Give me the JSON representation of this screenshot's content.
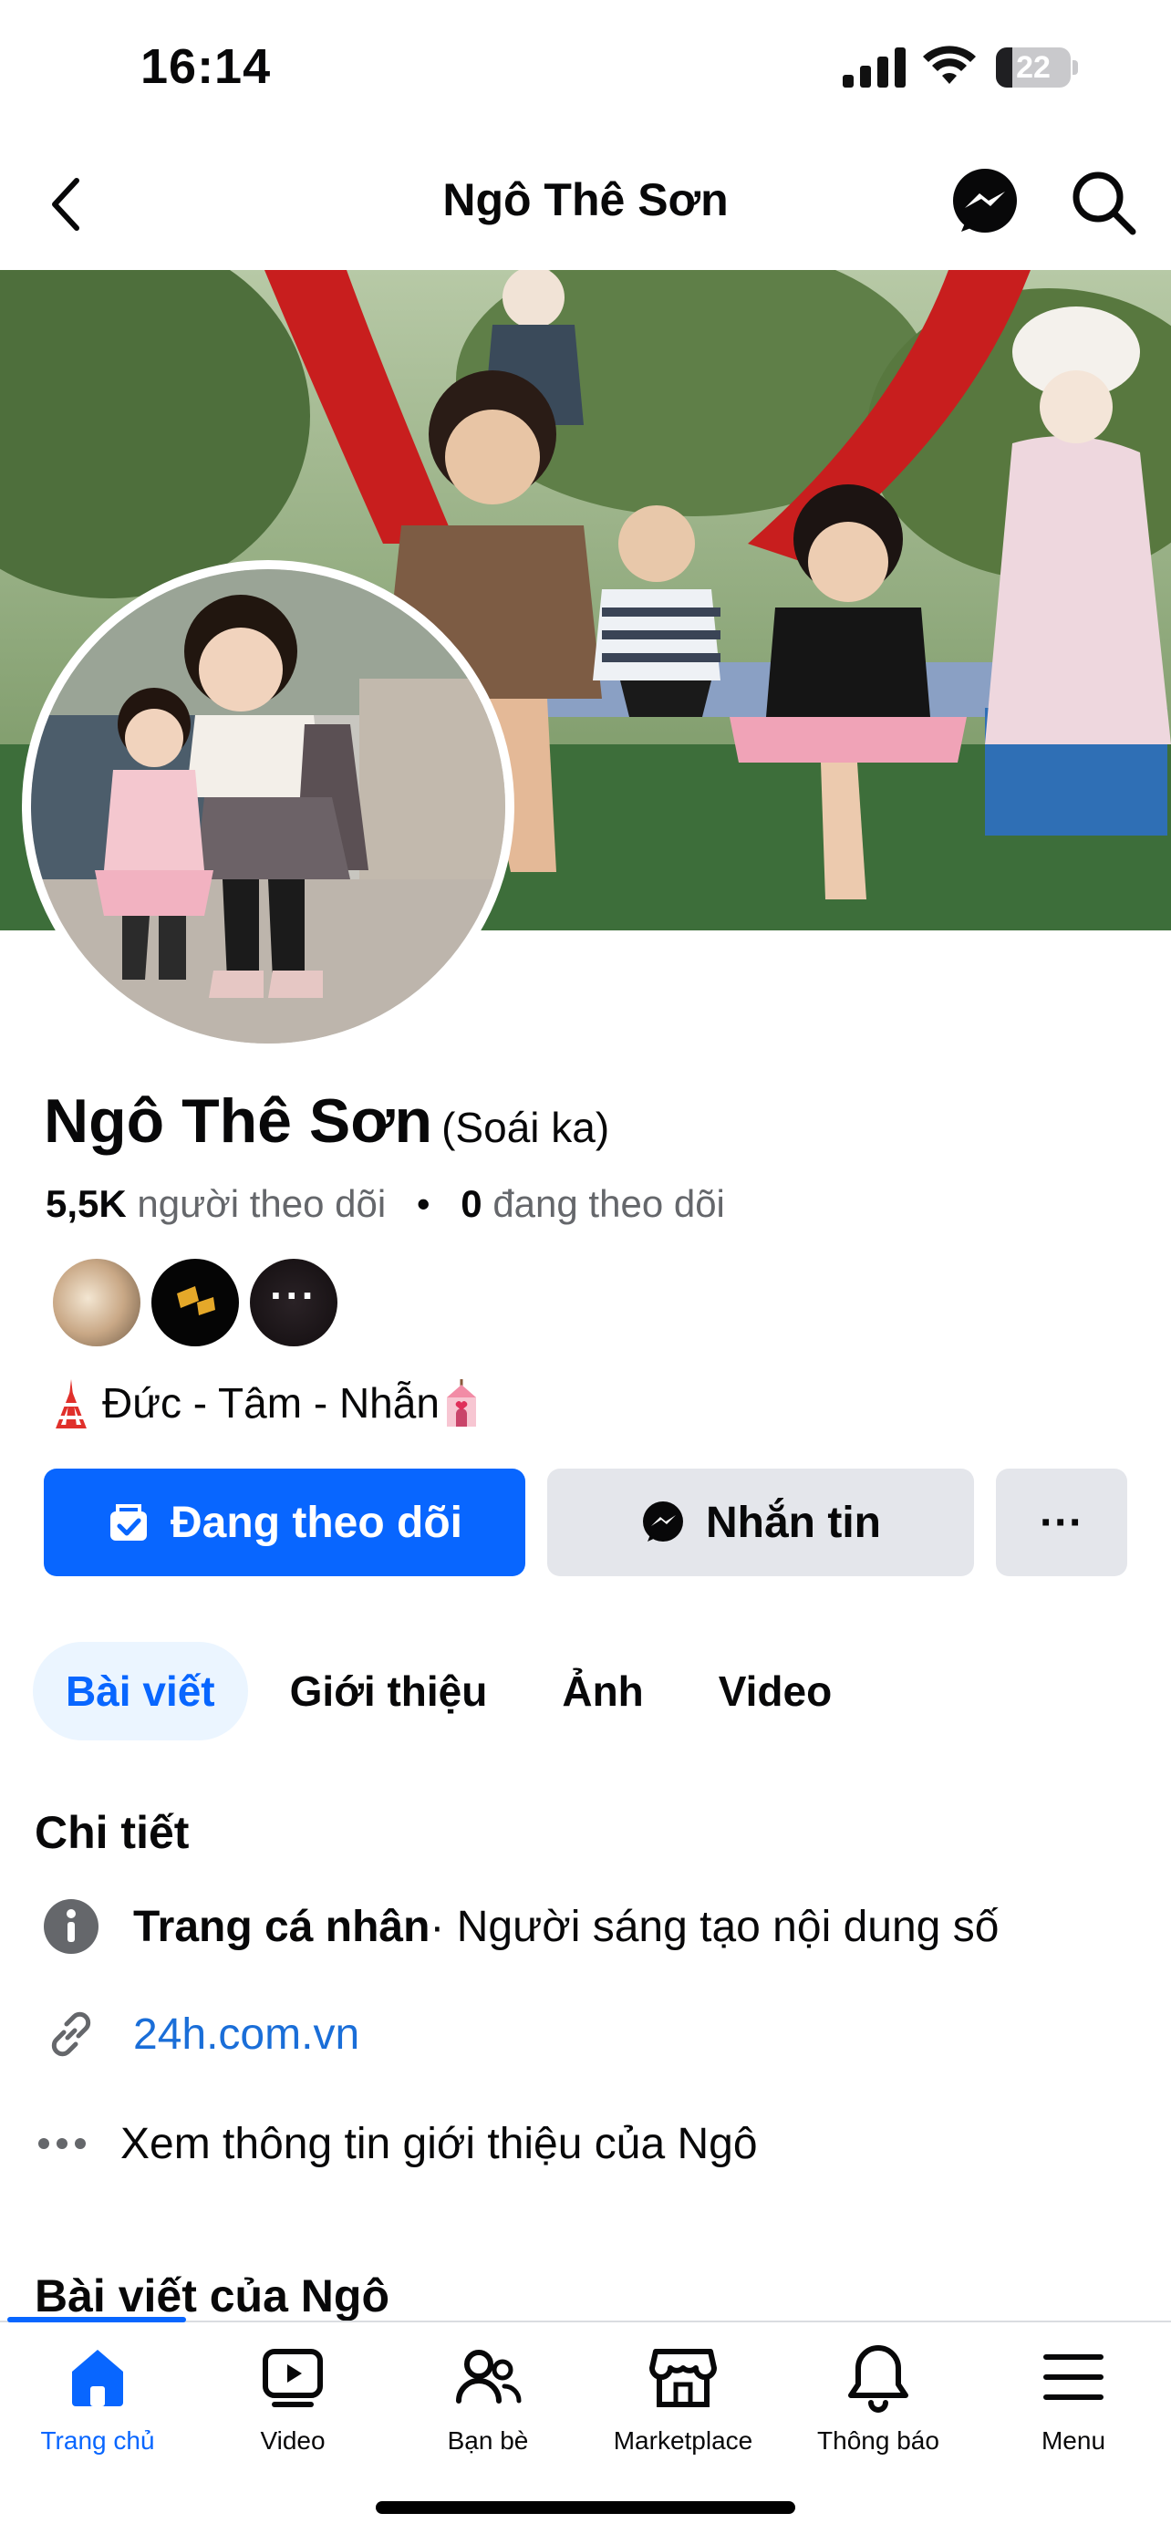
{
  "status_bar": {
    "time": "16:14",
    "battery_level": "22",
    "battery_fraction": 0.22
  },
  "nav": {
    "title": "Ngô Thê Sơn"
  },
  "profile": {
    "name": "Ngô Thê Sơn",
    "alternate_name": "(Soái ka)",
    "followers_count": "5,5K",
    "followers_label": "người theo dõi",
    "following_count": "0",
    "following_label": "đang theo dõi",
    "bio": "Đức - Tâm - Nhẫn"
  },
  "actions": {
    "follow_label": "Đang theo dõi",
    "message_label": "Nhắn tin",
    "more_label": "···"
  },
  "tabs": [
    {
      "label": "Bài viết",
      "active": true
    },
    {
      "label": "Giới thiệu"
    },
    {
      "label": "Ảnh"
    },
    {
      "label": "Video"
    }
  ],
  "details": {
    "title": "Chi tiết",
    "page_type_bold": "Trang cá nhân",
    "page_type_rest": " · Người sáng tạo nội dung số",
    "website": "24h.com.vn",
    "see_more": "Xem thông tin giới thiệu của Ngô"
  },
  "posts": {
    "title": "Bài viết của Ngô"
  },
  "tabbar": [
    {
      "label": "Trang chủ",
      "icon": "home-icon",
      "active": true
    },
    {
      "label": "Video",
      "icon": "video-icon"
    },
    {
      "label": "Bạn bè",
      "icon": "friends-icon"
    },
    {
      "label": "Marketplace",
      "icon": "marketplace-icon"
    },
    {
      "label": "Thông báo",
      "icon": "bell-icon"
    },
    {
      "label": "Menu",
      "icon": "menu-icon"
    }
  ],
  "colors": {
    "accent": "#0866ff",
    "button_gray": "#e4e6eb",
    "link": "#1a6ed8",
    "secondary_text": "#65676b"
  }
}
